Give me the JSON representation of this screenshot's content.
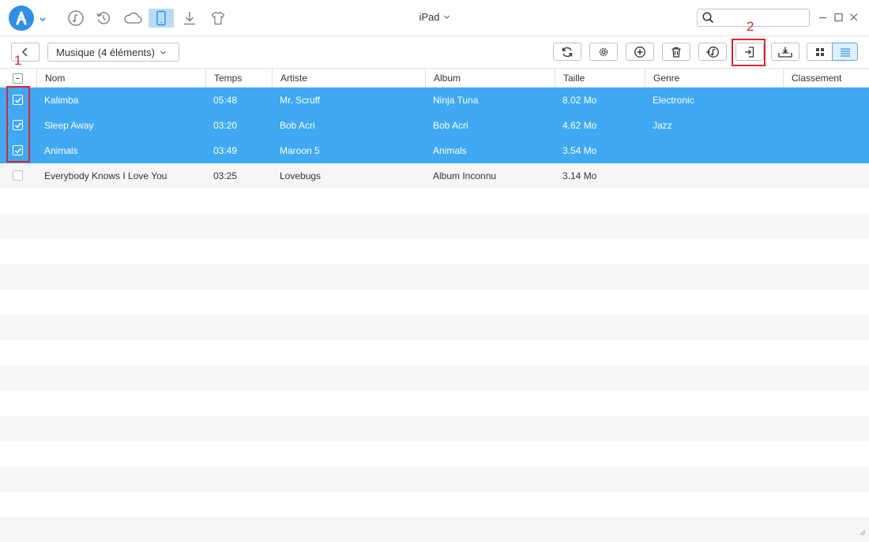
{
  "titlebar": {
    "device_name": "iPad",
    "search": {
      "value": "",
      "placeholder": ""
    },
    "nav_icons": [
      "music-icon",
      "restore-icon",
      "cloud-icon",
      "device-icon",
      "download-icon",
      "tshirt-icon"
    ],
    "active_nav": "device-icon"
  },
  "toolbar": {
    "category_label": "Musique (4 éléments)",
    "buttons": [
      "refresh-icon",
      "settings-icon",
      "add-icon",
      "delete-icon",
      "itunes-icon",
      "export-icon",
      "to-device-icon"
    ],
    "view_modes": [
      "grid-view-icon",
      "list-view-icon"
    ],
    "active_view": "list-view-icon"
  },
  "table": {
    "headers": {
      "name": "Nom",
      "time": "Temps",
      "artist": "Artiste",
      "album": "Album",
      "size": "Taille",
      "genre": "Genre",
      "rating": "Classement"
    },
    "rows": [
      {
        "selected": true,
        "name": "Kalimba",
        "time": "05:48",
        "artist": "Mr. Scruff",
        "album": "Ninja Tuna",
        "size": "8.02 Mo",
        "genre": "Electronic"
      },
      {
        "selected": true,
        "name": "Sleep Away",
        "time": "03:20",
        "artist": "Bob Acri",
        "album": "Bob Acri",
        "size": "4.62 Mo",
        "genre": "Jazz"
      },
      {
        "selected": true,
        "name": "Animals",
        "time": "03:49",
        "artist": "Maroon 5",
        "album": "Animals",
        "size": "3.54 Mo",
        "genre": ""
      },
      {
        "selected": false,
        "name": "Everybody Knows I Love You",
        "time": "03:25",
        "artist": "Lovebugs",
        "album": "Album Inconnu",
        "size": "3.14 Mo",
        "genre": ""
      }
    ]
  },
  "annotations": {
    "step1": "1",
    "step2": "2"
  },
  "colors": {
    "selection": "#3fa9f3",
    "accent": "#2f8fe6",
    "annotation": "#e0242c"
  }
}
